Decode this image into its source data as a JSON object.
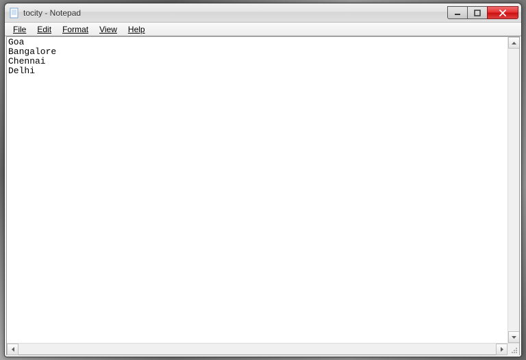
{
  "window": {
    "title": "tocity - Notepad",
    "app_name": "Notepad"
  },
  "menu": {
    "file": "File",
    "edit": "Edit",
    "format": "Format",
    "view": "View",
    "help": "Help"
  },
  "document": {
    "lines": [
      "Goa",
      "Bangalore",
      "Chennai",
      "Delhi"
    ]
  }
}
